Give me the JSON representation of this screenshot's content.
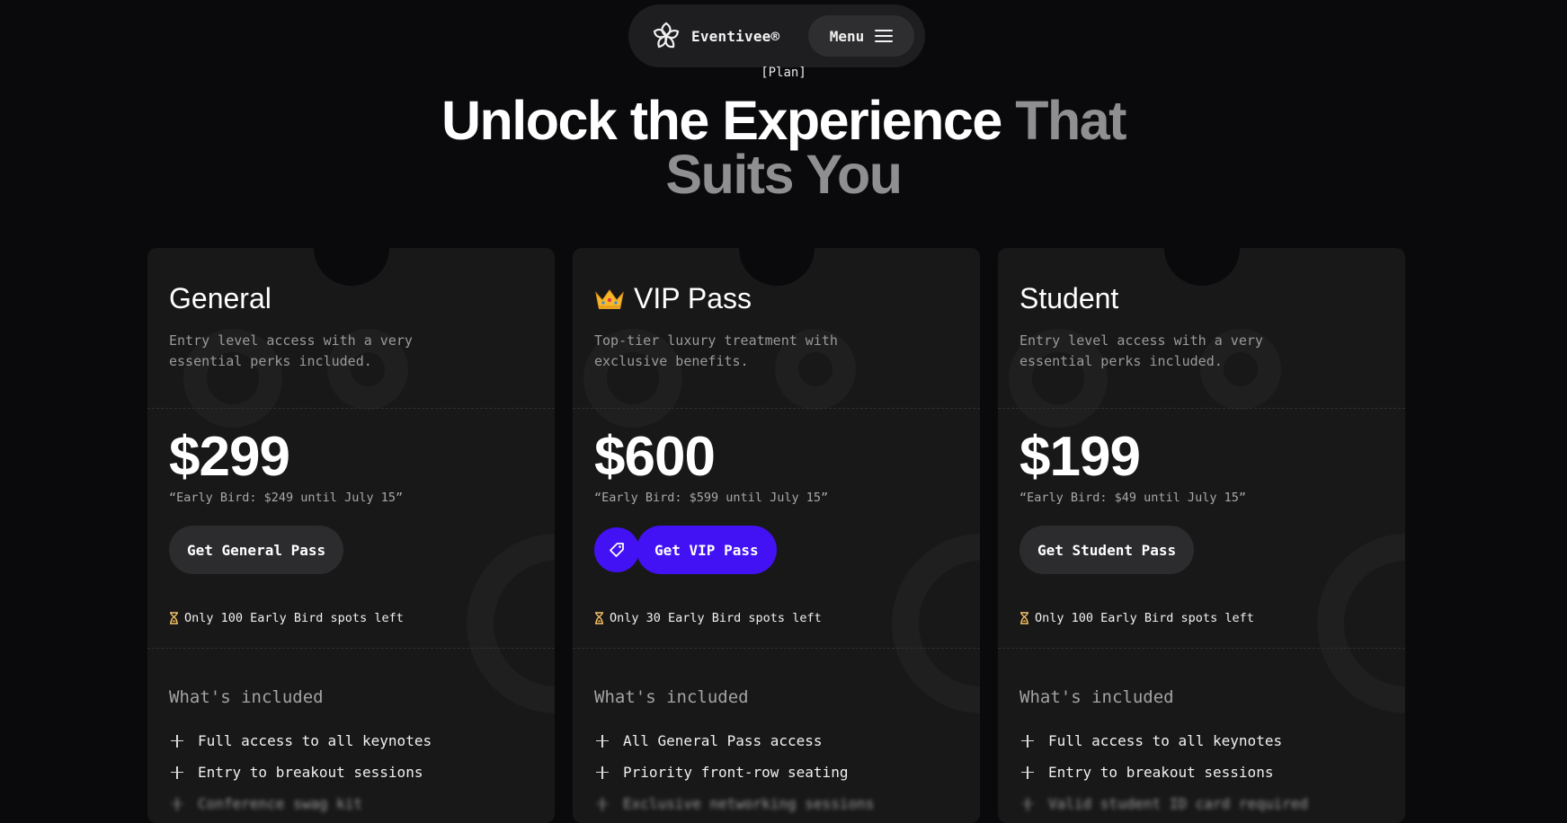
{
  "nav": {
    "brand_name": "Eventivee®",
    "menu_label": "Menu",
    "logo_icon": "flower-logo-icon",
    "menu_icon": "hamburger-icon"
  },
  "hero": {
    "tag": "[Plan]",
    "headline_white": "Unlock the Experience",
    "headline_gray_1": "That",
    "headline_gray_2": "Suits You"
  },
  "colors": {
    "background": "#0a0a0c",
    "card": "#181818",
    "accent": "#4212f5",
    "muted": "#8f8f91"
  },
  "plans": [
    {
      "title": "General",
      "description": "Entry level access with a very essential perks included.",
      "price": "$299",
      "early_bird": "“Early Bird: $249 until July 15”",
      "cta": "Get General Pass",
      "spots": "Only 100 Early Bird spots left",
      "included_title": "What's included",
      "features": [
        "Full access to all keynotes",
        "Entry to breakout sessions",
        "Conference swag kit"
      ]
    },
    {
      "title": "VIP Pass",
      "title_icon": "crown-icon",
      "description": "Top-tier luxury treatment with exclusive benefits.",
      "price": "$600",
      "early_bird": "“Early Bird: $599 until July 15”",
      "cta": "Get VIP Pass",
      "cta_icon": "tag-icon",
      "spots": "Only 30 Early Bird spots left",
      "included_title": "What's included",
      "features": [
        "All General Pass access",
        "Priority front-row seating",
        "Exclusive networking sessions"
      ]
    },
    {
      "title": "Student",
      "description": "Entry level access with a very essential perks included.",
      "price": "$199",
      "early_bird": "“Early Bird: $49 until July 15”",
      "cta": "Get Student Pass",
      "spots": "Only 100 Early Bird spots left",
      "included_title": "What's included",
      "features": [
        "Full access to all keynotes",
        "Entry to breakout sessions",
        "Valid student ID card required"
      ]
    }
  ]
}
